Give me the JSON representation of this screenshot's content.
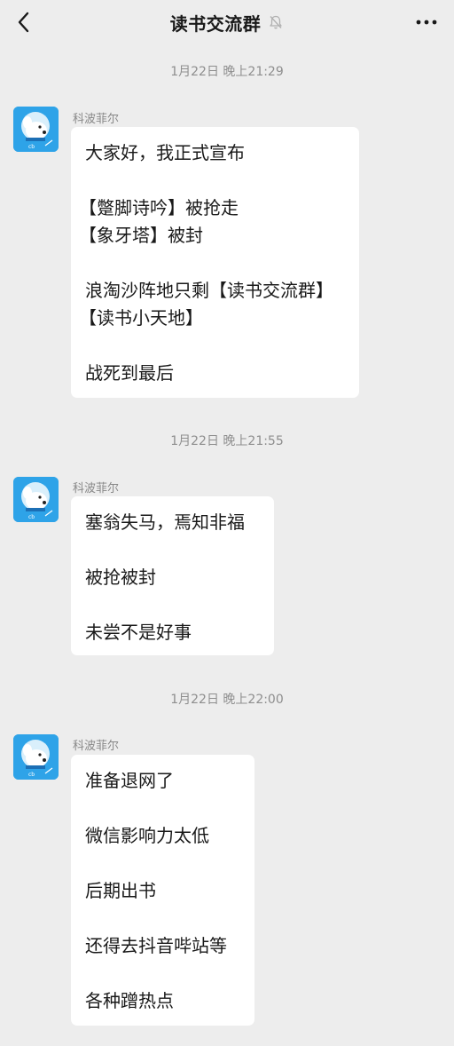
{
  "header": {
    "back_icon": "chevron-left-icon",
    "title": "读书交流群",
    "mute_icon": "bell-muted-icon",
    "more_icon": "ellipsis-icon"
  },
  "messages": [
    {
      "timestamp": "1月22日 晚上21:29",
      "sender": "科波菲尔",
      "avatar_icon": "dog-avatar",
      "lines": [
        "大家好，我正式宣布",
        "【蹩脚诗吟】被抢走",
        "【象牙塔】被封",
        "浪淘沙阵地只剩【读书交流群】",
        "【读书小天地】",
        "战死到最后"
      ]
    },
    {
      "timestamp": "1月22日 晚上21:55",
      "sender": "科波菲尔",
      "avatar_icon": "dog-avatar",
      "lines": [
        "塞翁失马，焉知非福",
        "被抢被封",
        "未尝不是好事"
      ]
    },
    {
      "timestamp": "1月22日 晚上22:00",
      "sender": "科波菲尔",
      "avatar_icon": "dog-avatar",
      "lines": [
        "准备退网了",
        "微信影响力太低",
        "后期出书",
        "还得去抖音哔站等",
        "各种蹭热点"
      ]
    }
  ],
  "colors": {
    "background": "#ededed",
    "bubble": "#ffffff",
    "avatar": "#2ea3e8",
    "text": "#191919",
    "meta": "#8e8e8e"
  }
}
